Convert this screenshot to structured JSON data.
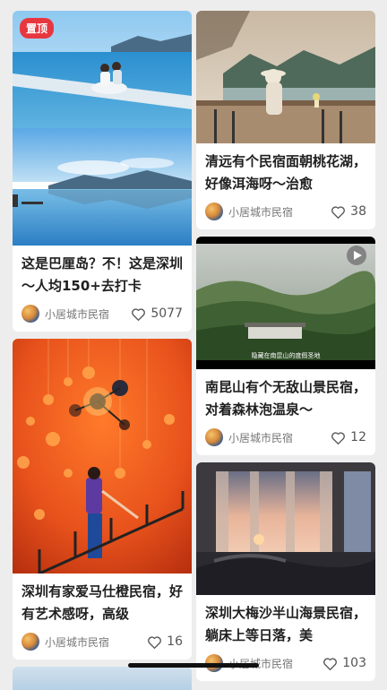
{
  "posts": [
    {
      "badge": "置顶",
      "title": "这是巴厘岛？不！这是深圳～人均150+去打卡",
      "author": "小居城市民宿",
      "likes": "5077",
      "icon": "heart-icon"
    },
    {
      "title": "清远有个民宿面朝桃花湖，好像洱海呀～治愈",
      "author": "小居城市民宿",
      "likes": "38",
      "icon": "heart-icon"
    },
    {
      "video_caption": "隐藏在南昆山的度假圣地",
      "title": "南昆山有个无敌山景民宿，对着森林泡温泉～",
      "author": "小居城市民宿",
      "likes": "12",
      "icon": "heart-icon"
    },
    {
      "title": "深圳有家爱马仕橙民宿，好有艺术感呀，高级",
      "author": "小居城市民宿",
      "likes": "16",
      "icon": "heart-icon"
    },
    {
      "title": "深圳大梅沙半山海景民宿，躺床上等日落，美",
      "author": "小居城市民宿",
      "likes": "103",
      "icon": "heart-icon"
    }
  ]
}
